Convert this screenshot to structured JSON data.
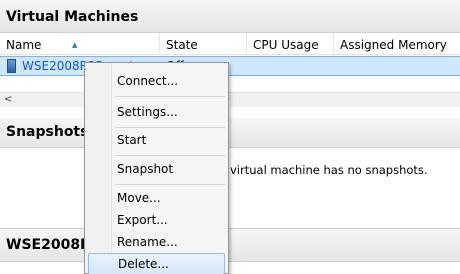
{
  "panels": {
    "virtual_machines": "Virtual Machines",
    "snapshots": "Snapshots",
    "details": "WSE2008R"
  },
  "columns": [
    "Name",
    "State",
    "CPU Usage",
    "Assigned Memory"
  ],
  "vm_row": {
    "name": "WSE2008R2Parent",
    "state": "Off"
  },
  "scrollbar": {
    "left_arrow": "<"
  },
  "snapshots_message": "virtual machine has no snapshots.",
  "context_menu": {
    "connect": "Connect...",
    "settings": "Settings...",
    "start": "Start",
    "snapshot": "Snapshot",
    "move": "Move...",
    "export": "Export...",
    "rename": "Rename...",
    "delete": "Delete..."
  }
}
